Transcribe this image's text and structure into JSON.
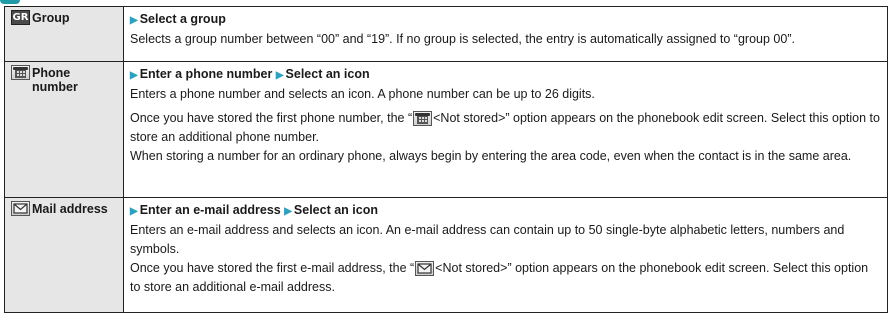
{
  "rows": [
    {
      "label": "Group",
      "icon": "group-icon",
      "icon_text": "GR",
      "path": [
        "Select a group"
      ],
      "lines": [
        "Selects a group number between “00” and “19”. If no group is selected, the entry is automatically assigned to “group 00”."
      ]
    },
    {
      "label": "Phone number",
      "icon": "phone-icon",
      "path": [
        "Enter a phone number",
        "Select an icon"
      ],
      "line1": "Enters a phone number and selects an icon. A phone number can be up to 26 digits.",
      "line2_pre": "Once you have stored the first phone number, the “",
      "line2_post": "<Not stored>” option appears on the phonebook edit screen. Select this option to store an additional phone number.",
      "line3": "When storing a number for an ordinary phone, always begin by entering the area code, even when the contact is in the same area."
    },
    {
      "label": "Mail address",
      "icon": "mail-icon",
      "path": [
        "Enter an e-mail address",
        "Select an icon"
      ],
      "line1": "Enters an e-mail address and selects an icon. An e-mail address can contain up to 50 single-byte alphabetic letters, numbers and symbols.",
      "line2_pre": "Once you have stored the first e-mail address, the “",
      "line2_post": "<Not stored>” option appears on the phonebook edit screen. Select this option to store an additional e-mail address."
    }
  ],
  "colors": {
    "accent": "#2aa3c0",
    "label_bg": "#e6e6e6",
    "border": "#222222",
    "teal_cap": "#1f9aa8"
  }
}
